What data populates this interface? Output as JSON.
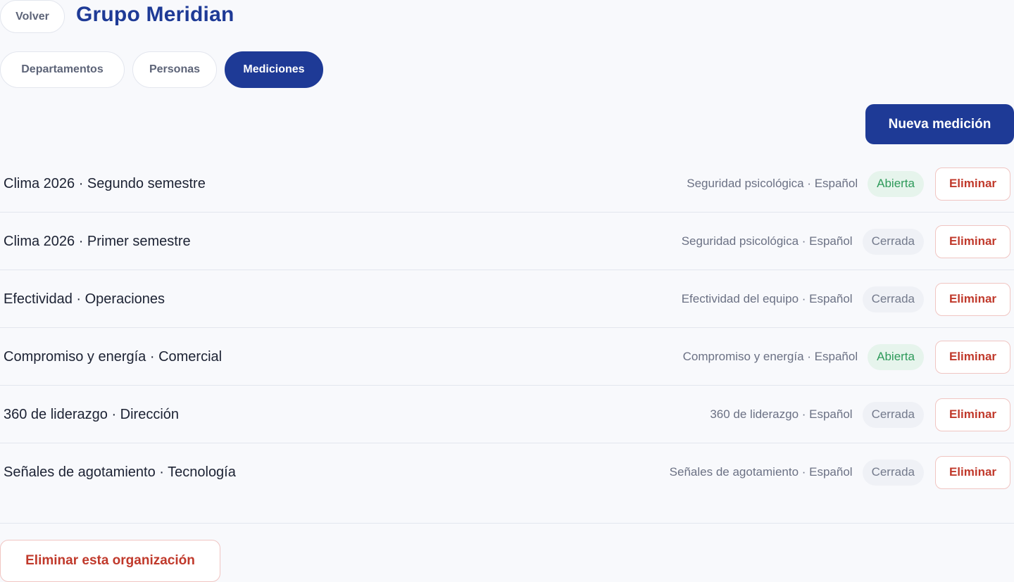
{
  "header": {
    "back_label": "Volver",
    "org_name": "Grupo Meridian"
  },
  "tabs": [
    {
      "label": "Departamentos",
      "active": false
    },
    {
      "label": "Personas",
      "active": false
    },
    {
      "label": "Mediciones",
      "active": true
    }
  ],
  "actions": {
    "new_measurement_label": "Nueva medición",
    "delete_org_label": "Eliminar esta organización"
  },
  "measurements": [
    {
      "title": "Clima 2026 · Segundo semestre",
      "meta": "Seguridad psicológica · Español",
      "status": "Abierta",
      "delete_label": "Eliminar"
    },
    {
      "title": "Clima 2026 · Primer semestre",
      "meta": "Seguridad psicológica · Español",
      "status": "Cerrada",
      "delete_label": "Eliminar"
    },
    {
      "title": "Efectividad · Operaciones",
      "meta": "Efectividad del equipo · Español",
      "status": "Cerrada",
      "delete_label": "Eliminar"
    },
    {
      "title": "Compromiso y energía · Comercial",
      "meta": "Compromiso y energía · Español",
      "status": "Abierta",
      "delete_label": "Eliminar"
    },
    {
      "title": "360 de liderazgo · Dirección",
      "meta": "360 de liderazgo · Español",
      "status": "Cerrada",
      "delete_label": "Eliminar"
    },
    {
      "title": "Señales de agotamiento · Tecnología",
      "meta": "Señales de agotamiento · Español",
      "status": "Cerrada",
      "delete_label": "Eliminar"
    }
  ],
  "colors": {
    "primary": "#1e3a96",
    "danger": "#c0392b",
    "open_status": "#2e9a5a",
    "closed_status": "#737a8c"
  }
}
